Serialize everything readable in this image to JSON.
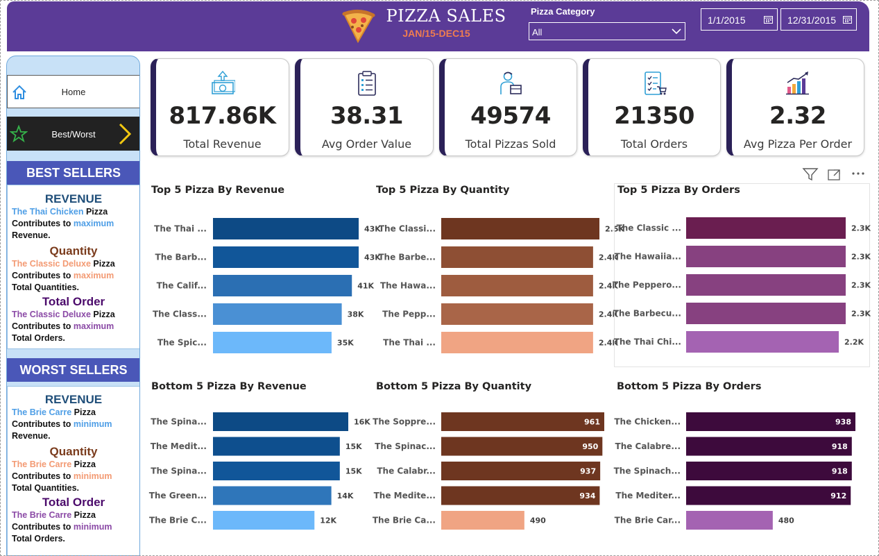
{
  "header": {
    "title": "PIZZA SALES",
    "subtitle": "JAN/15-DEC15",
    "category_label": "Pizza Category",
    "category_value": "All",
    "date_start": "1/1/2015",
    "date_end": "12/31/2015",
    "bg_color": "#5b3b97"
  },
  "nav": {
    "home_label": "Home",
    "best_worst_label": "Best/Worst"
  },
  "best_sellers": {
    "heading": "BEST SELLERS",
    "revenue": {
      "title": "REVENUE",
      "name": "The Thai Chicken",
      "l1_suffix": " Pizza",
      "l2_prefix": "Contributes to ",
      "l2_word": "maximum",
      "l3": "Revenue."
    },
    "quantity": {
      "title": "Quantity",
      "name": "The Classic Deluxe",
      "l1_suffix": " Pizza",
      "l2_prefix": "Contributes to ",
      "l2_word": "maximum",
      "l3": "Total Quantities."
    },
    "orders": {
      "title": "Total Order",
      "name": "The Classic Deluxe",
      "l1_suffix": " Pizza",
      "l2_prefix": "Contributes to ",
      "l2_word": "maximum",
      "l3": "Total Orders."
    }
  },
  "worst_sellers": {
    "heading": "WORST SELLERS",
    "revenue": {
      "title": "REVENUE",
      "name": "The Brie Carre",
      "l1_suffix": " Pizza",
      "l2_prefix": "Contributes to ",
      "l2_word": "minimum",
      "l3": "Revenue."
    },
    "quantity": {
      "title": "Quantity",
      "name": "The Brie Carre",
      "l1_suffix": " Pizza",
      "l2_prefix": "Contributes to ",
      "l2_word": "minimum",
      "l3": "Total Quantities."
    },
    "orders": {
      "title": "Total Order",
      "name": "The Brie Carre",
      "l1_suffix": " Pizza",
      "l2_prefix": "Contributes to ",
      "l2_word": "minimum",
      "l3": "Total Orders."
    }
  },
  "kpis": [
    {
      "value": "817.86K",
      "label": "Total Revenue",
      "icon": "money-icon"
    },
    {
      "value": "38.31",
      "label": "Avg Order Value",
      "icon": "clipboard-icon"
    },
    {
      "value": "49574",
      "label": "Total Pizzas Sold",
      "icon": "delivery-person-icon"
    },
    {
      "value": "21350",
      "label": "Total Orders",
      "icon": "order-list-icon"
    },
    {
      "value": "2.32",
      "label": "Avg Pizza Per Order",
      "icon": "growth-chart-icon"
    }
  ],
  "chart_data": [
    {
      "type": "bar",
      "orientation": "horizontal",
      "title": "Top 5 Pizza By Revenue",
      "categories": [
        "The Thai ...",
        "The Barb...",
        "The Calif...",
        "The Class...",
        "The Spic..."
      ],
      "values": [
        43000,
        43000,
        41000,
        38000,
        35000
      ],
      "labels": [
        "43K",
        "43K",
        "41K",
        "38K",
        "35K"
      ],
      "colors": [
        "#0d4a85",
        "#115699",
        "#2b6fb3",
        "#4a90d4",
        "#6cb8fa"
      ],
      "label_inside": false
    },
    {
      "type": "bar",
      "orientation": "horizontal",
      "title": "Top 5 Pizza By Quantity",
      "categories": [
        "The Classi...",
        "The Barbe...",
        "The Hawa...",
        "The Pepp...",
        "The Thai ..."
      ],
      "values": [
        2500,
        2400,
        2400,
        2400,
        2400
      ],
      "labels": [
        "2.5K",
        "2.4K",
        "2.4K",
        "2.4K",
        "2.4K"
      ],
      "colors": [
        "#6e3620",
        "#8e4f34",
        "#9e5c3f",
        "#a96548",
        "#f0a483"
      ],
      "label_inside": false
    },
    {
      "type": "bar",
      "orientation": "horizontal",
      "title": "Top 5 Pizza By Orders",
      "categories": [
        "The Classic ...",
        "The Hawaiia...",
        "The Peppero...",
        "The Barbecu...",
        "The Thai Chi..."
      ],
      "values": [
        2300,
        2300,
        2300,
        2300,
        2200
      ],
      "labels": [
        "2.3K",
        "2.3K",
        "2.3K",
        "2.3K",
        "2.2K"
      ],
      "colors": [
        "#6a1e50",
        "#874180",
        "#874180",
        "#874180",
        "#a463b2"
      ],
      "label_inside": false
    },
    {
      "type": "bar",
      "orientation": "horizontal",
      "title": "Bottom 5 Pizza By Revenue",
      "categories": [
        "The Spina...",
        "The Medit...",
        "The Spina...",
        "The Green...",
        "The Brie C..."
      ],
      "values": [
        16000,
        15000,
        15000,
        14000,
        12000
      ],
      "labels": [
        "16K",
        "15K",
        "15K",
        "14K",
        "12K"
      ],
      "colors": [
        "#0d4a85",
        "#0e4f8e",
        "#115699",
        "#2f76ba",
        "#6cb8fa"
      ],
      "label_inside": false
    },
    {
      "type": "bar",
      "orientation": "horizontal",
      "title": "Bottom 5 Pizza By Quantity",
      "categories": [
        "The Soppre...",
        "The Spinac...",
        "The Calabr...",
        "The Medite...",
        "The Brie Ca..."
      ],
      "values": [
        961,
        950,
        937,
        934,
        490
      ],
      "labels": [
        "961",
        "950",
        "937",
        "934",
        "490"
      ],
      "colors": [
        "#6e3620",
        "#6e3620",
        "#6e3620",
        "#6e3620",
        "#f0a483"
      ],
      "label_inside": true
    },
    {
      "type": "bar",
      "orientation": "horizontal",
      "title": "Bottom 5 Pizza By Orders",
      "categories": [
        "The Chicken...",
        "The Calabre...",
        "The Spinach...",
        "The Mediter...",
        "The Brie Car..."
      ],
      "values": [
        938,
        918,
        918,
        912,
        480
      ],
      "labels": [
        "938",
        "918",
        "918",
        "912",
        "480"
      ],
      "colors": [
        "#3d0a3c",
        "#3d0a3c",
        "#3d0a3c",
        "#3d0a3c",
        "#a463b2"
      ],
      "label_inside": true
    }
  ]
}
